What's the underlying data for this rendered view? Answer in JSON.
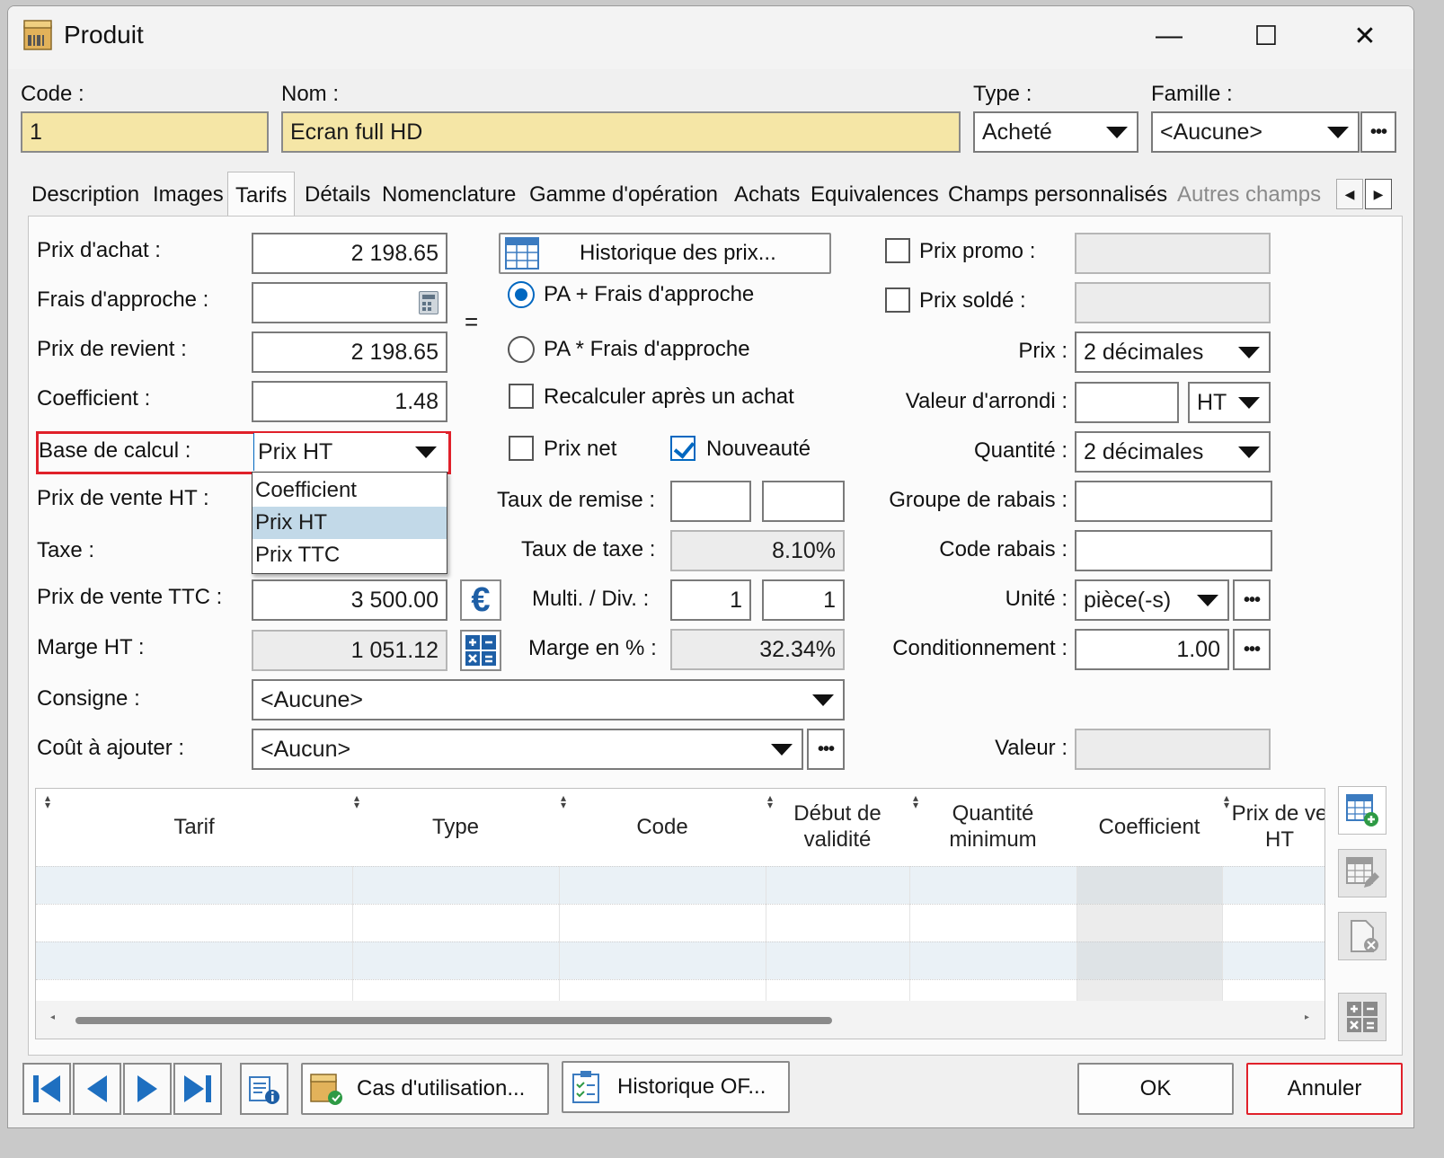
{
  "window": {
    "title": "Produit",
    "minimize": "—",
    "maximize": "☐",
    "close": "✕"
  },
  "header": {
    "code_label": "Code :",
    "code_value": "1",
    "nom_label": "Nom :",
    "nom_value": "Ecran full HD",
    "type_label": "Type :",
    "type_value": "Acheté",
    "famille_label": "Famille :",
    "famille_value": "<Aucune>"
  },
  "tabs": [
    "Description",
    "Images",
    "Tarifs",
    "Détails",
    "Nomenclature",
    "Gamme d'opération",
    "Achats",
    "Equivalences",
    "Champs personnalisés",
    "Autres champs"
  ],
  "active_tab": "Tarifs",
  "left": {
    "prix_achat_label": "Prix d'achat :",
    "prix_achat_value": "2 198.65",
    "frais_label": "Frais d'approche :",
    "frais_value": "",
    "prix_revient_label": "Prix de revient :",
    "prix_revient_value": "2 198.65",
    "coefficient_label": "Coefficient :",
    "coefficient_value": "1.48",
    "base_calcul_label": "Base de calcul :",
    "base_calcul_value": "Prix HT",
    "base_calcul_options": [
      "Coefficient",
      "Prix HT",
      "Prix TTC"
    ],
    "prix_vente_ht_label": "Prix de vente HT :",
    "taxe_label": "Taxe :",
    "prix_vente_ttc_label": "Prix de vente TTC :",
    "prix_vente_ttc_value": "3 500.00",
    "marge_ht_label": "Marge HT :",
    "marge_ht_value": "1 051.12",
    "consigne_label": "Consigne :",
    "consigne_value": "<Aucune>",
    "cout_label": "Coût à ajouter :",
    "cout_value": "<Aucun>"
  },
  "middle": {
    "historique_btn": "Historique des prix...",
    "equals": "=",
    "radio_plus": "PA + Frais d'approche",
    "radio_mult": "PA * Frais d'approche",
    "recalculer": "Recalculer après un achat",
    "prix_net": "Prix net",
    "nouveaute": "Nouveauté",
    "taux_remise_label": "Taux de remise :",
    "taux_taxe_label": "Taux de taxe :",
    "taux_taxe_value": "8.10%",
    "multi_div_label": "Multi. / Div. :",
    "multi_value": "1",
    "div_value": "1",
    "marge_pct_label": "Marge en % :",
    "marge_pct_value": "32.34%"
  },
  "right": {
    "prix_promo_label": "Prix promo :",
    "prix_solde_label": "Prix soldé :",
    "prix_label": "Prix :",
    "prix_value": "2 décimales",
    "valeur_arrondi_label": "Valeur d'arrondi :",
    "arrondi_unit": "HT",
    "quantite_label": "Quantité :",
    "quantite_value": "2 décimales",
    "groupe_rabais_label": "Groupe de rabais :",
    "code_rabais_label": "Code rabais :",
    "unite_label": "Unité :",
    "unite_value": "pièce(-s)",
    "conditionnement_label": "Conditionnement :",
    "conditionnement_value": "1.00",
    "valeur_label": "Valeur :"
  },
  "grid": {
    "columns": [
      "Tarif",
      "Type",
      "Code",
      "Début de validité",
      "Quantité minimum",
      "Coefficient",
      "Prix de ve HT"
    ]
  },
  "footer": {
    "cas_utilisation": "Cas d'utilisation...",
    "historique_of": "Historique OF...",
    "ok": "OK",
    "annuler": "Annuler"
  },
  "colors": {
    "accent": "#0067c0",
    "highlight_border": "#e0202a",
    "required_field": "#f5e6a6",
    "selected_item": "#c2d9e8"
  }
}
